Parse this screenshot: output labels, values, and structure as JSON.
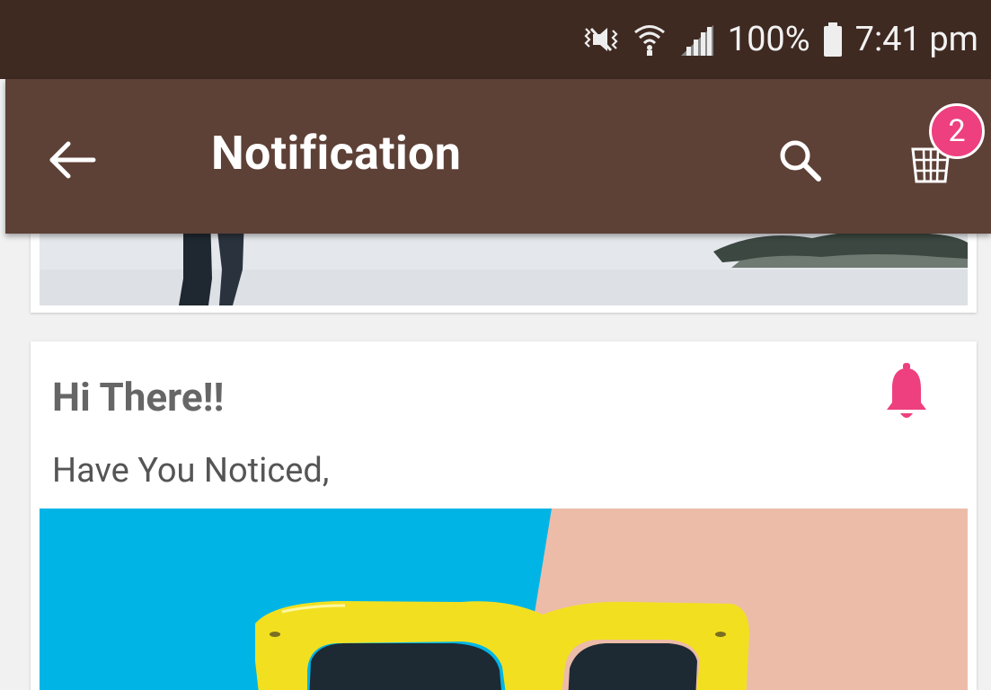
{
  "status_bar": {
    "battery": "100%",
    "time": "7:41 pm",
    "icons": [
      "vibrate-icon",
      "wifi-icon",
      "signal-icon",
      "battery-icon"
    ]
  },
  "app_bar": {
    "title": "Notification",
    "back_icon": "arrow-left-icon",
    "search_icon": "search-icon",
    "cart_icon": "basket-icon",
    "cart_badge": "2"
  },
  "notifications": [
    {
      "title": "Hi There!!",
      "message": "Have You Noticed,",
      "icon": "bell-icon"
    }
  ],
  "colors": {
    "status_bar": "#3f2a22",
    "app_bar": "#5d4036",
    "accent": "#ee3f7e",
    "background": "#f1f1f1"
  }
}
